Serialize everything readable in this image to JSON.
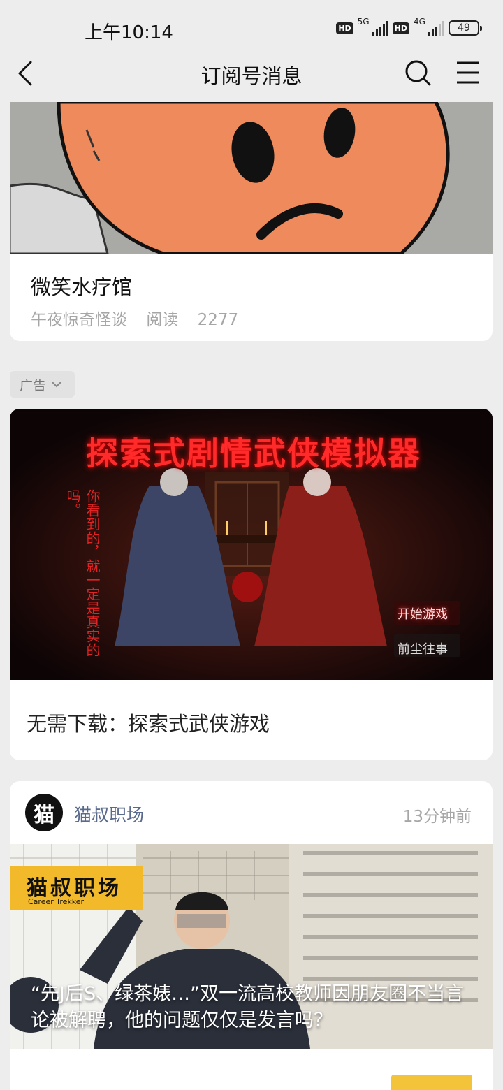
{
  "status_bar": {
    "time": "上午10:14",
    "net1": "5G",
    "net2": "4G",
    "hd": "HD",
    "battery": "49"
  },
  "nav": {
    "title": "订阅号消息",
    "icons": [
      "back-arrow-icon",
      "search-icon",
      "menu-icon"
    ]
  },
  "article1": {
    "title": "微笑水疗馆",
    "account": "午夜惊奇怪谈",
    "reads_label": "阅读",
    "reads": "2277"
  },
  "ad": {
    "tag": "广告",
    "banner_title": "探索式剧情武侠模拟器",
    "left_text": "你看到的，就一定是真实的吗。",
    "start_button": "开始游戏",
    "secondary_button": "前尘往事",
    "caption": "无需下载：探索式武侠游戏"
  },
  "article2": {
    "avatar_char": "猫",
    "account": "猫叔职场",
    "time_ago": "13分钟前",
    "brand_logo": "猫叔职场",
    "brand_sub": "Career Trekker",
    "headline": "“先J后S、绿茶婊…”双一流高校教师因朋友圈不当言论被解聘，他的问题仅仅是发言吗？"
  },
  "colors": {
    "background": "#ededed",
    "card": "#ffffff",
    "account_link": "#596a8c",
    "muted": "#a6a6a6",
    "ad_red": "#ff2a2a"
  }
}
